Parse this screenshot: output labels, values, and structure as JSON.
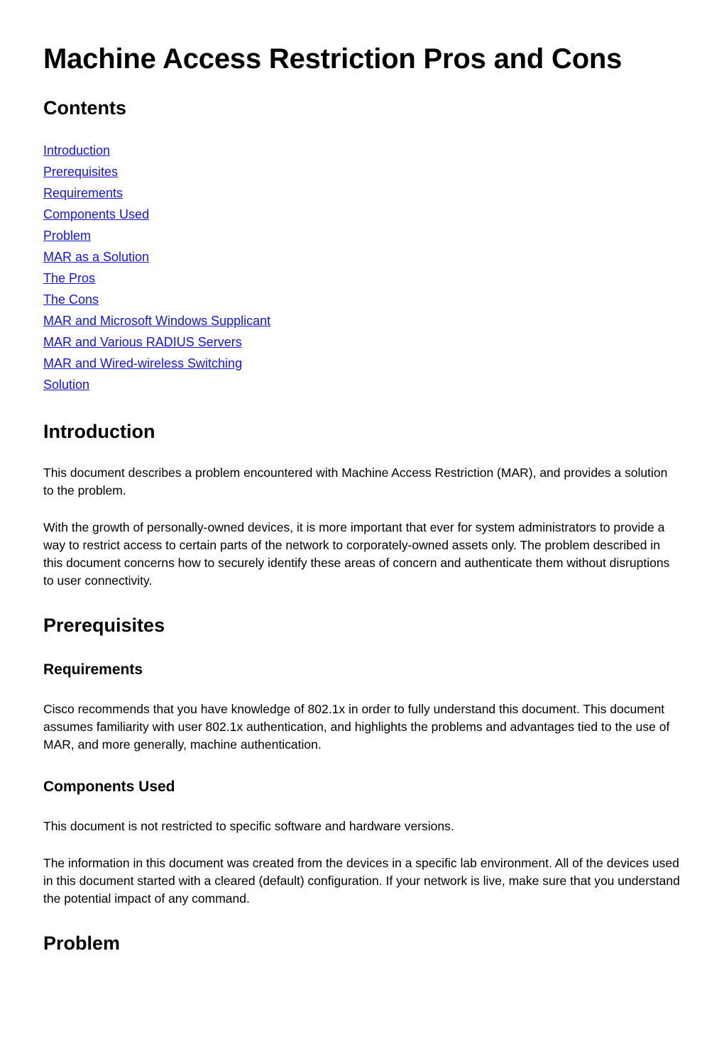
{
  "document": {
    "title": "Machine Access Restriction Pros and Cons",
    "link_color": "#1414e0",
    "text_color": "#000000",
    "background_color": "#ffffff"
  },
  "contents": {
    "heading": "Contents",
    "links": [
      "Introduction",
      "Prerequisites",
      "Requirements",
      "Components Used",
      "Problem",
      "MAR as a Solution",
      "The Pros",
      "The Cons",
      "MAR and Microsoft Windows Supplicant",
      "MAR and Various RADIUS Servers",
      "MAR and Wired-wireless Switching",
      "Solution"
    ]
  },
  "introduction": {
    "heading": "Introduction",
    "paragraphs": [
      "This document describes a problem encountered with Machine Access Restriction (MAR), and provides a solution to the problem.",
      "With the growth of personally-owned devices, it is more important that ever for system administrators to provide a way to restrict access to certain parts of the network to corporately-owned assets only. The problem described in this document concerns how to securely identify these areas of concern and authenticate them without disruptions to user connectivity."
    ]
  },
  "prerequisites": {
    "heading": "Prerequisites",
    "requirements": {
      "heading": "Requirements",
      "paragraph": "Cisco recommends that you have knowledge of 802.1x in order to fully understand this document. This document assumes familiarity with user 802.1x authentication, and highlights the problems and advantages tied to the use of MAR, and more generally, machine authentication."
    },
    "components_used": {
      "heading": "Components Used",
      "paragraphs": [
        "This document is not restricted to specific software and hardware versions.",
        "The information in this document was created from the devices in a specific lab environment. All of the devices used in this document started with a cleared (default) configuration. If your network is live, make sure that you understand the potential impact of any command."
      ]
    }
  },
  "problem": {
    "heading": "Problem"
  }
}
